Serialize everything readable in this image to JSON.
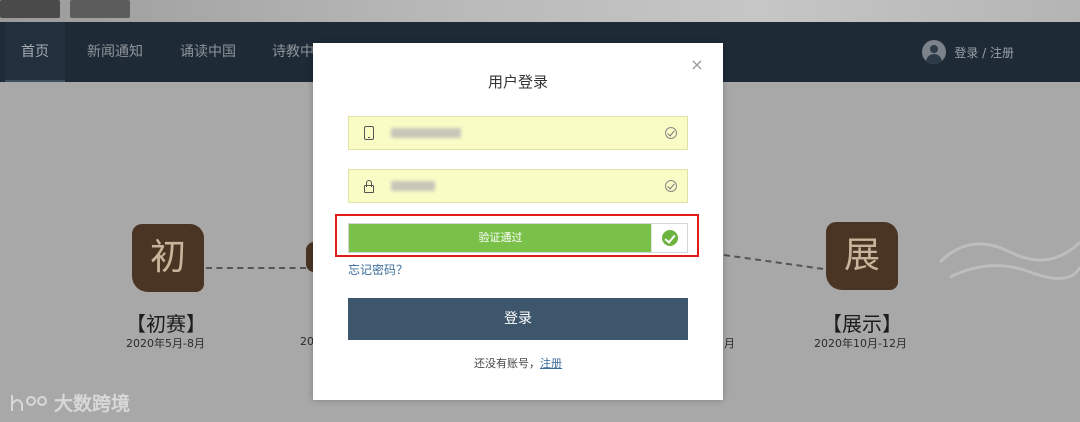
{
  "nav": {
    "items": [
      "首页",
      "新闻通知",
      "诵读中国",
      "诗教中"
    ],
    "active_index": 0,
    "user_label": "登录 / 注册"
  },
  "stages": [
    {
      "seal": "初",
      "title": "【初赛】",
      "date": "2020年5月-8月"
    },
    {
      "seal": "展",
      "title": "【展示】",
      "date": "2020年10月-12月"
    }
  ],
  "partial_stage_dates": {
    "left": "20",
    "right": "月"
  },
  "partial_stage_title_left": "【",
  "watermark": {
    "text": "大数跨境"
  },
  "modal": {
    "title": "用户登录",
    "close_icon": "×",
    "phone_field": {
      "value": ""
    },
    "password_field": {
      "value": ""
    },
    "verify_label": "验证通过",
    "forgot_link": "忘记密码？",
    "login_button": "登录",
    "no_account_text": "还没有账号，",
    "register_link": "注册"
  },
  "colors": {
    "nav_bg": "#1e2a36",
    "login_button": "#3e566c",
    "verify_green": "#7ac149",
    "highlight_red": "#e21b1b",
    "field_bg": "#fafcc6"
  }
}
